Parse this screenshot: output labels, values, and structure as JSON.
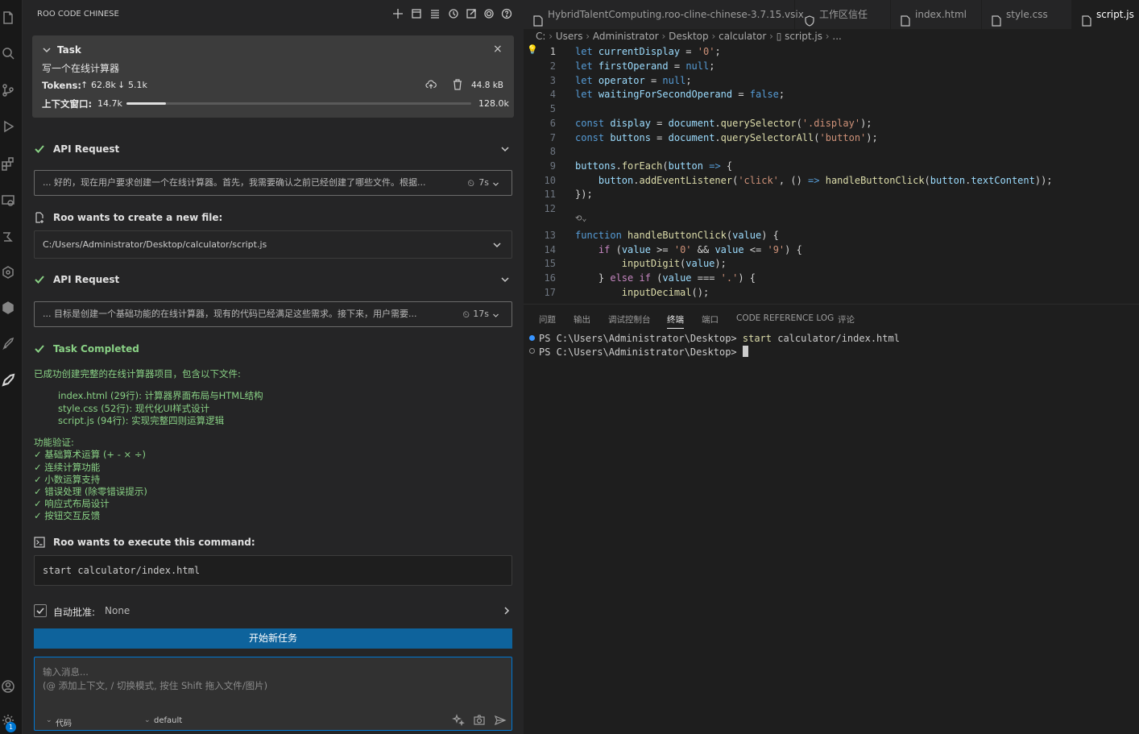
{
  "sidebar": {
    "title": "ROO CODE CHINESE",
    "task": {
      "label": "Task",
      "description": "写一个在线计算器",
      "tokens_label": "Tokens:",
      "tokens_up": "62.8k",
      "tokens_down": "5.1k",
      "size": "44.8 kB",
      "context_label": "上下文窗口:",
      "context_used": "14.7k",
      "context_max": "128.0k",
      "context_fraction": 0.115
    },
    "api_request_1": {
      "label": "API Request",
      "reasoning": "... 好的，现在用户要求创建一个在线计算器。首先，我需要确认之前已经创建了哪些文件。根据...",
      "time": "7s"
    },
    "create_file": {
      "label": "Roo wants to create a new file:",
      "path": "C:/Users/Administrator/Desktop/calculator/script.js"
    },
    "api_request_2": {
      "label": "API Request",
      "reasoning": "... 目标是创建一个基础功能的在线计算器，现有的代码已经满足这些需求。接下来，用户需要...",
      "time": "17s"
    },
    "completed": {
      "label": "Task Completed",
      "summary": "已成功创建完整的在线计算器项目，包含以下文件:",
      "files": [
        "index.html (29行): 计算器界面布局与HTML结构",
        "style.css (52行): 现代化UI样式设计",
        "script.js (94行): 实现完整四则运算逻辑"
      ],
      "features_title": "功能验证:",
      "features": [
        "✓ 基础算术运算 (+ - × ÷)",
        "✓ 连续计算功能",
        "✓ 小数运算支持",
        "✓ 错误处理 (除零错误提示)",
        "✓ 响应式布局设计",
        "✓ 按钮交互反馈"
      ]
    },
    "command": {
      "label": "Roo wants to execute this command:",
      "text": "start calculator/index.html"
    },
    "auto_approve": {
      "label": "自动批准:",
      "value": "None"
    },
    "new_task_button": "开始新任务",
    "input": {
      "placeholder_line1": "输入消息...",
      "placeholder_line2": "(@ 添加上下文, / 切换模式, 按住 Shift 拖入文件/图片)",
      "mode": "代码",
      "profile": "default"
    }
  },
  "editor": {
    "tabs": [
      {
        "label": "HybridTalentComputing.roo-cline-chinese-3.7.15.vsix",
        "active": false
      },
      {
        "label": "工作区信任",
        "active": false
      },
      {
        "label": "index.html",
        "active": false
      },
      {
        "label": "style.css",
        "active": false
      },
      {
        "label": "script.js",
        "active": true
      }
    ],
    "breadcrumb": [
      "C:",
      "Users",
      "Administrator",
      "Desktop",
      "calculator",
      "script.js",
      "..."
    ],
    "line_numbers": [
      "1",
      "2",
      "3",
      "4",
      "5",
      "6",
      "7",
      "8",
      "9",
      "10",
      "11",
      "12",
      "13",
      "14",
      "15",
      "16",
      "17"
    ]
  },
  "panel": {
    "tabs": [
      "问题",
      "输出",
      "调试控制台",
      "终端",
      "端口",
      "CODE REFERENCE LOG",
      "评论"
    ],
    "active_tab": "终端",
    "terminal_lines": [
      {
        "prompt": "PS C:\\Users\\Administrator\\Desktop> ",
        "command": "start",
        "args": " calculator/index.html"
      },
      {
        "prompt": "PS C:\\Users\\Administrator\\Desktop> ",
        "command": "",
        "args": ""
      }
    ]
  },
  "colors": {
    "accent": "#0078d4",
    "success": "#89d185",
    "button": "#0e639c"
  }
}
